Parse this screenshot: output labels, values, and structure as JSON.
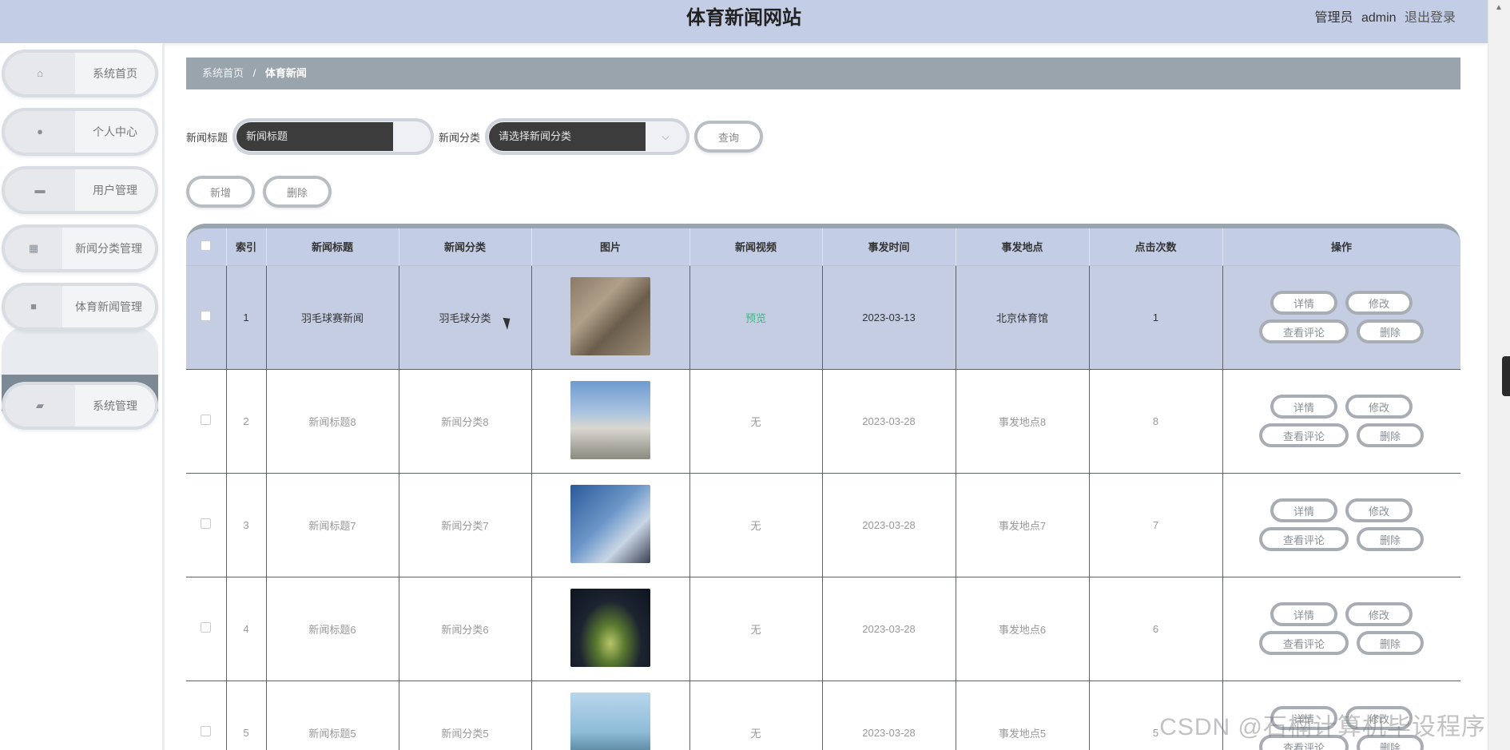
{
  "header": {
    "title": "体育新闻网站",
    "role": "管理员",
    "username": "admin",
    "logout": "退出登录"
  },
  "sidebar": {
    "items": [
      {
        "label": "系统首页",
        "icon": "home-icon"
      },
      {
        "label": "个人中心",
        "icon": "user-icon"
      },
      {
        "label": "用户管理",
        "icon": "users-icon"
      },
      {
        "label": "新闻分类管理",
        "icon": "grid-icon"
      },
      {
        "label": "体育新闻管理",
        "icon": "video-icon"
      },
      {
        "label": "系统管理",
        "icon": "briefcase-icon"
      }
    ],
    "active_sub": "体育新闻"
  },
  "breadcrumb": {
    "home": "系统首页",
    "current": "体育新闻"
  },
  "search": {
    "title_label": "新闻标题",
    "title_placeholder": "新闻标题",
    "category_label": "新闻分类",
    "category_placeholder": "请选择新闻分类",
    "query_button": "查询"
  },
  "actions": {
    "add": "新增",
    "delete": "删除"
  },
  "table": {
    "headers": [
      "索引",
      "新闻标题",
      "新闻分类",
      "图片",
      "新闻视频",
      "事发时间",
      "事发地点",
      "点击次数",
      "操作"
    ],
    "ops": {
      "detail": "详情",
      "edit": "修改",
      "comments": "查看评论",
      "delete": "删除"
    },
    "rows": [
      {
        "index": "1",
        "title": "羽毛球赛新闻",
        "category": "羽毛球分类",
        "video": "预览",
        "time": "2023-03-13",
        "place": "北京体育馆",
        "clicks": "1"
      },
      {
        "index": "2",
        "title": "新闻标题8",
        "category": "新闻分类8",
        "video": "无",
        "time": "2023-03-28",
        "place": "事发地点8",
        "clicks": "8"
      },
      {
        "index": "3",
        "title": "新闻标题7",
        "category": "新闻分类7",
        "video": "无",
        "time": "2023-03-28",
        "place": "事发地点7",
        "clicks": "7"
      },
      {
        "index": "4",
        "title": "新闻标题6",
        "category": "新闻分类6",
        "video": "无",
        "time": "2023-03-28",
        "place": "事发地点6",
        "clicks": "6"
      },
      {
        "index": "5",
        "title": "新闻标题5",
        "category": "新闻分类5",
        "video": "无",
        "time": "2023-03-28",
        "place": "事发地点5",
        "clicks": "5"
      }
    ]
  },
  "watermark": "CSDN @石楠计算机毕设程序"
}
